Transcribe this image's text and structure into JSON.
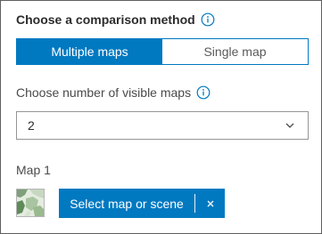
{
  "comparison": {
    "heading": "Choose a comparison method",
    "info_icon": "info-icon",
    "options": [
      {
        "label": "Multiple maps",
        "selected": true
      },
      {
        "label": "Single map",
        "selected": false
      }
    ]
  },
  "visible_maps": {
    "label": "Choose number of visible maps",
    "info_icon": "info-icon",
    "value": "2",
    "dropdown_icon": "chevron-down-icon"
  },
  "map1": {
    "label": "Map 1",
    "thumbnail_icon": "map-thumbnail",
    "select_label": "Select map or scene",
    "clear_icon": "close-icon"
  },
  "colors": {
    "accent": "#0079c1",
    "border": "#959595",
    "text": "#323232"
  }
}
